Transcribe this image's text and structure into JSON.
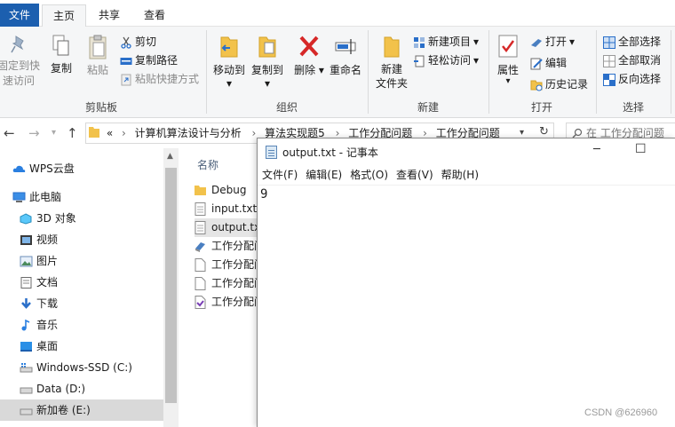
{
  "ribbon_tabs": [
    "文件",
    "主页",
    "共享",
    "查看"
  ],
  "clipboard": {
    "group_label": "剪贴板",
    "pin_label_1": "固定到快",
    "pin_label_2": "速访问",
    "copy": "复制",
    "paste": "粘贴",
    "cut": "剪切",
    "copy_path": "复制路径",
    "paste_shortcut": "粘贴快捷方式"
  },
  "organize": {
    "group_label": "组织",
    "move_to": "移动到",
    "copy_to": "复制到",
    "delete": "删除",
    "rename": "重命名"
  },
  "new_group": {
    "group_label": "新建",
    "new_folder_1": "新建",
    "new_folder_2": "文件夹",
    "new_item": "新建项目",
    "easy_access": "轻松访问"
  },
  "open_group": {
    "group_label": "打开",
    "properties": "属性",
    "open": "打开",
    "edit": "编辑",
    "history": "历史记录"
  },
  "select_group": {
    "group_label": "选择",
    "select_all": "全部选择",
    "select_none": "全部取消",
    "invert": "反向选择"
  },
  "address": {
    "crumbs": [
      "计算机算法设计与分析",
      "算法实现题5",
      "工作分配问题",
      "工作分配问题"
    ],
    "overflow": "«",
    "search_placeholder": "在 工作分配问题"
  },
  "nav_items": [
    "WPS云盘",
    "此电脑",
    "3D 对象",
    "视频",
    "图片",
    "文档",
    "下载",
    "音乐",
    "桌面",
    "Windows-SSD (C:)",
    "Data (D:)",
    "新加卷 (E:)"
  ],
  "file_list": {
    "column_name": "名称",
    "files": [
      "Debug",
      "input.txt",
      "output.txt",
      "工作分配问题",
      "工作分配问题",
      "工作分配问题",
      "工作分配问题"
    ]
  },
  "notepad": {
    "title": "output.txt - 记事本",
    "menu": [
      "文件(F)",
      "编辑(E)",
      "格式(O)",
      "查看(V)",
      "帮助(H)"
    ],
    "content": "9"
  },
  "watermark": "CSDN @626960",
  "colors": {
    "file_tab": "#1c5faf",
    "delete_x": "#d62828",
    "folder": "#f2c24b"
  }
}
